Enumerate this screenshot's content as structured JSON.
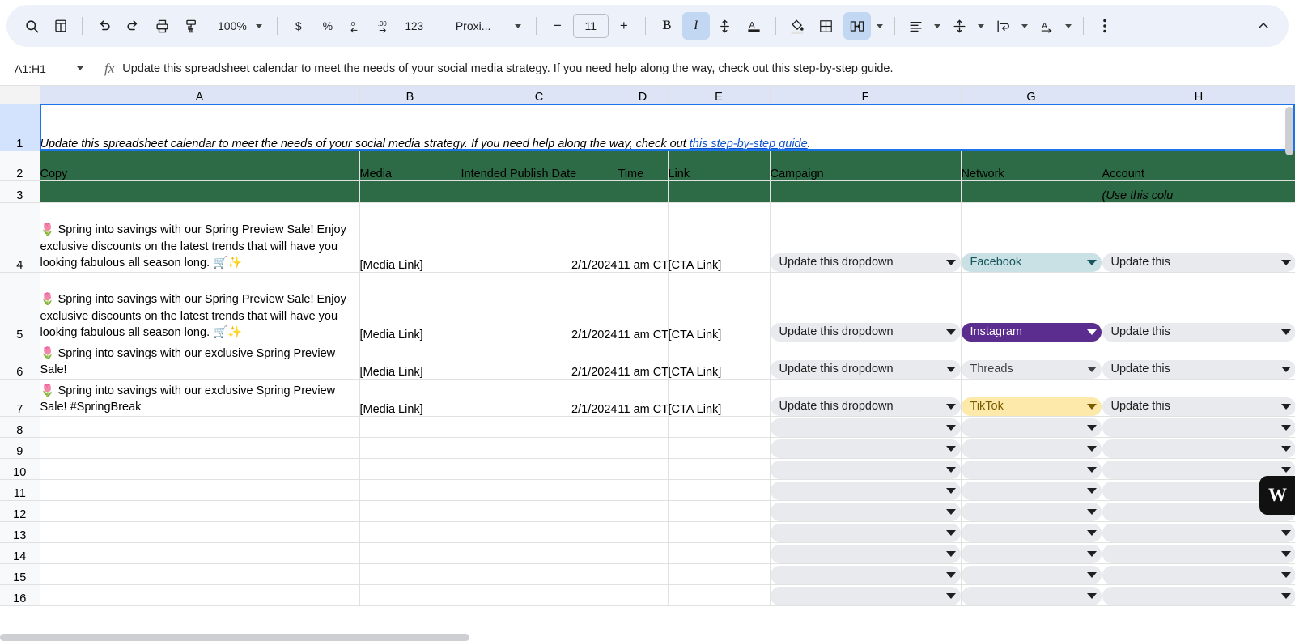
{
  "toolbar": {
    "search_icon": "search-icon",
    "menus_icon": "all-sheets-icon",
    "undo_icon": "undo-icon",
    "redo_icon": "redo-icon",
    "print_icon": "print-icon",
    "paint_format_icon": "paint-format-icon",
    "zoom_value": "100%",
    "currency_label": "$",
    "percent_label": "%",
    "decrease_decimal_icon": "decrease-decimal-icon",
    "increase_decimal_icon": "increase-decimal-icon",
    "more_formats_label": "123",
    "font_family": "Proxi...",
    "font_decrease": "−",
    "font_size": "11",
    "font_increase": "+",
    "bold_label": "B",
    "italic_label": "I",
    "strikethrough_icon": "strikethrough-icon",
    "text_color_label": "A",
    "fill_color_icon": "fill-color-icon",
    "borders_icon": "borders-icon",
    "merge_cells_icon": "merge-cells-icon",
    "horizontal_align_icon": "horizontal-align-icon",
    "vertical_align_icon": "vertical-align-icon",
    "text_wrap_icon": "text-wrapping-icon",
    "text_rotation_icon": "text-rotation-icon",
    "more_options_icon": "more-options-icon",
    "collapse_icon": "collapse-toolbar-icon"
  },
  "formula_bar": {
    "name_box": "A1:H1",
    "fx": "fx",
    "value": "Update this spreadsheet calendar to meet the needs of your social media strategy. If you need help along the way, check out this step-by-step guide."
  },
  "grid": {
    "columns": [
      "A",
      "B",
      "C",
      "D",
      "E",
      "F",
      "G",
      "H"
    ],
    "row_numbers": [
      "1",
      "2",
      "3",
      "4",
      "5",
      "6",
      "7",
      "8",
      "9",
      "10",
      "11",
      "12",
      "13",
      "14",
      "15",
      "16"
    ],
    "banner": {
      "text_before": "Update this spreadsheet calendar to meet the needs of your social media strategy. If you need help along the way, check out ",
      "link_text": "this step-by-step guide",
      "text_after": "."
    },
    "headers": [
      "Copy",
      "Media",
      "Intended Publish Date",
      "Time",
      "Link",
      "Campaign",
      "Network",
      "Account"
    ],
    "header_subtext": "(Use this colu",
    "rows": [
      {
        "copy": "🌷  Spring into savings with our Spring Preview Sale! Enjoy exclusive discounts on the latest trends that will have you looking fabulous all season long. 🛒✨",
        "media": "[Media Link]",
        "date": "2/1/2024",
        "time": "11 am CT",
        "link": "[CTA Link]",
        "campaign": "Update this dropdown",
        "network": "Facebook",
        "network_style": "facebook",
        "account": "Update this"
      },
      {
        "copy": "🌷  Spring into savings with our Spring Preview Sale! Enjoy exclusive discounts on the latest trends that will have you looking fabulous all season long. 🛒✨",
        "media": "[Media Link]",
        "date": "2/1/2024",
        "time": "11 am CT",
        "link": "[CTA Link]",
        "campaign": "Update this dropdown",
        "network": "Instagram",
        "network_style": "instagram",
        "account": "Update this"
      },
      {
        "copy": "🌷  Spring into savings with our exclusive Spring Preview Sale!",
        "media": "[Media Link]",
        "date": "2/1/2024",
        "time": "11 am CT",
        "link": "[CTA Link]",
        "campaign": "Update this dropdown",
        "network": "Threads",
        "network_style": "threads",
        "account": "Update this"
      },
      {
        "copy": "🌷  Spring into savings with our exclusive Spring Preview Sale! #SpringBreak",
        "media": "[Media Link]",
        "date": "2/1/2024",
        "time": "11 am CT",
        "link": "[CTA Link]",
        "campaign": "Update this dropdown",
        "network": "TikTok",
        "network_style": "tiktok",
        "account": "Update this"
      }
    ],
    "empty_rows": [
      "8",
      "9",
      "10",
      "11",
      "12",
      "13",
      "14",
      "15",
      "16"
    ]
  },
  "badge": {
    "logo": "W"
  },
  "colors": {
    "header_green": "#2d6a46",
    "toolbar_bg": "#edf2fa",
    "link_blue": "#1155cc",
    "selection_blue": "#1a73e8",
    "facebook_chip": "#c9e0e4",
    "instagram_chip": "#5b2d8e",
    "threads_chip": "#e8eaed",
    "tiktok_chip": "#fde9a9"
  }
}
